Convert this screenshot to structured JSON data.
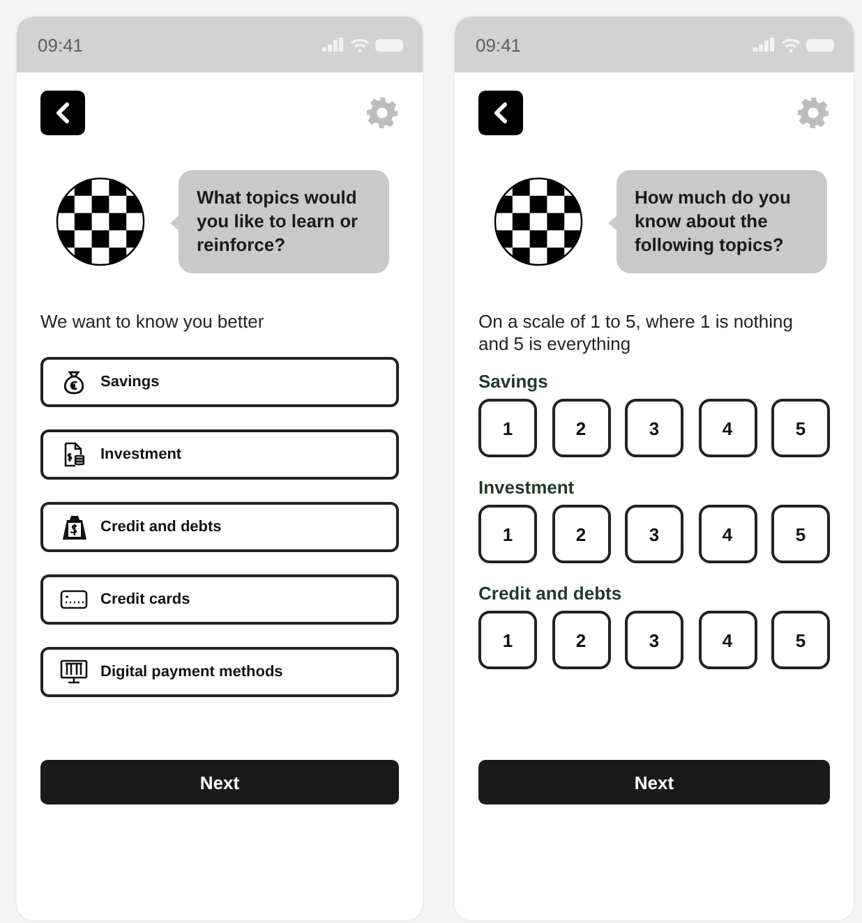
{
  "screens": [
    {
      "kind": "topics",
      "status_bar": {
        "time": "09:41"
      },
      "message": "What topics would you like to learn or reinforce?",
      "intro": "We want to know you better",
      "topics": [
        {
          "label": "Savings"
        },
        {
          "label": "Investment"
        },
        {
          "label": "Credit and debts"
        },
        {
          "label": "Credit cards"
        },
        {
          "label": "Digital payment methods"
        }
      ],
      "next_button": "Next"
    },
    {
      "kind": "ratings",
      "status_bar": {
        "time": "09:41"
      },
      "message": "How much do you know about the following topics?",
      "intro": "On a scale of 1 to 5, where 1 is nothing and 5 is everything",
      "ratings": [
        {
          "topic": "Savings",
          "options": [
            "1",
            "2",
            "3",
            "4",
            "5"
          ]
        },
        {
          "topic": "Investment",
          "options": [
            "1",
            "2",
            "3",
            "4",
            "5"
          ]
        },
        {
          "topic": "Credit and debts",
          "options": [
            "1",
            "2",
            "3",
            "4",
            "5"
          ]
        }
      ],
      "next_button": "Next"
    }
  ]
}
